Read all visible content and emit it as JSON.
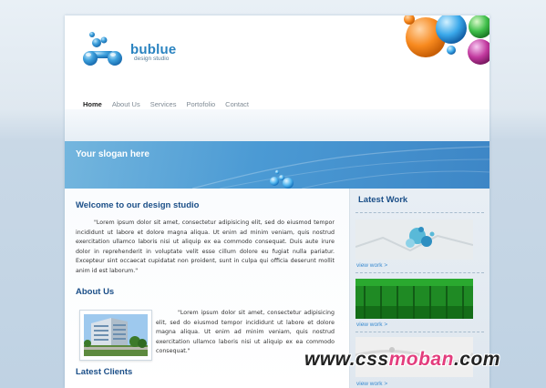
{
  "brand": {
    "name": "bublue",
    "tagline": "design studio"
  },
  "nav": {
    "items": [
      "Home",
      "About Us",
      "Services",
      "Portofolio",
      "Contact"
    ],
    "active": "Home"
  },
  "banner": {
    "slogan": "Your slogan here"
  },
  "welcome": {
    "title": "Welcome to our design studio",
    "text": "\"Lorem ipsum dolor sit amet, consectetur adipisicing elit, sed do eiusmod tempor incididunt ut labore et dolore magna aliqua. Ut enim ad minim veniam, quis nostrud exercitation ullamco laboris nisi ut aliquip ex ea commodo consequat. Duis aute irure dolor in reprehenderit in voluptate velit esse cillum dolore eu fugiat nulla pariatur. Excepteur sint occaecat cupidatat non proident, sunt in culpa qui officia deserunt mollit anim id est laborum.\""
  },
  "about": {
    "title": "About Us",
    "text": "\"Lorem ipsum dolor sit amet, consectetur adipisicing elit, sed do eiusmod tempor incididunt ut labore et dolore magna aliqua. Ut enim ad minim veniam, quis nostrud exercitation ullamco laboris nisi ut aliquip ex ea commodo consequat.\""
  },
  "clients": {
    "title": "Latest Clients"
  },
  "sidebar": {
    "title": "Latest Work",
    "items": [
      {
        "link": "view work >"
      },
      {
        "link": "view work >"
      },
      {
        "link": "view work >"
      }
    ]
  },
  "watermark": {
    "prefix": "www.css",
    "highlight": "moban",
    "suffix": ".com"
  },
  "colors": {
    "accent": "#1b4f88",
    "banner": "#4b9ad4",
    "link": "#3a8bd0"
  }
}
